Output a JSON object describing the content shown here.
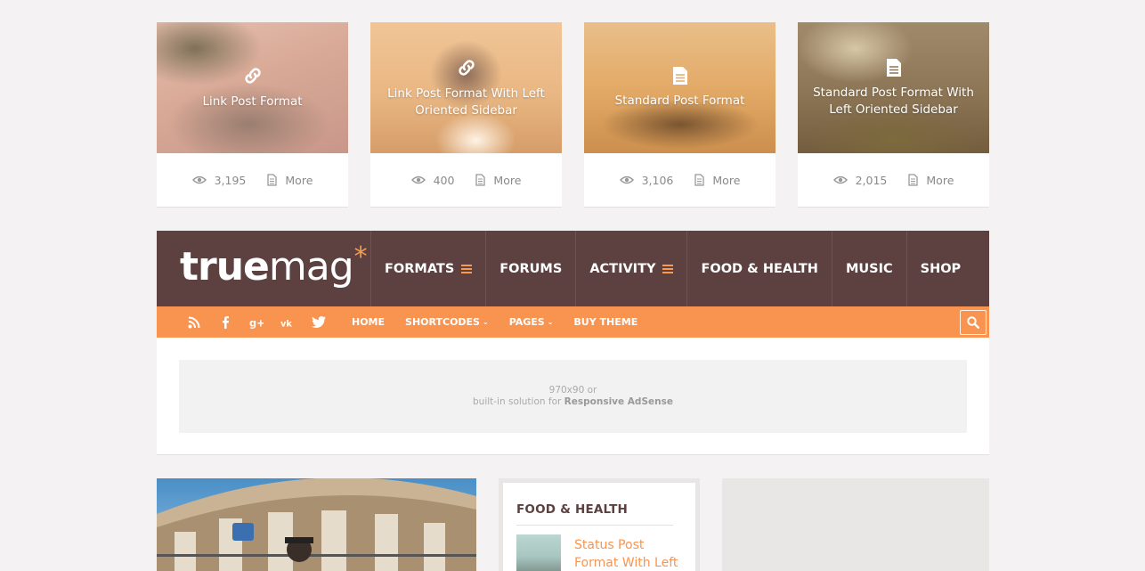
{
  "posts": [
    {
      "title": "Link Post Format",
      "format_icon": "link-icon",
      "views": "3,195",
      "more_label": "More"
    },
    {
      "title": "Link Post Format With Left Oriented Sidebar",
      "format_icon": "link-icon",
      "views": "400",
      "more_label": "More"
    },
    {
      "title": "Standard Post Format",
      "format_icon": "document-icon",
      "views": "3,106",
      "more_label": "More"
    },
    {
      "title": "Standard Post Format With Left Oriented Sidebar",
      "format_icon": "document-icon",
      "views": "2,015",
      "more_label": "More"
    }
  ],
  "header": {
    "logo_bold": "true",
    "logo_light": "mag",
    "logo_star": "*",
    "nav": [
      {
        "label": "FORMATS",
        "has_menu": true
      },
      {
        "label": "FORUMS",
        "has_menu": false
      },
      {
        "label": "ACTIVITY",
        "has_menu": true
      },
      {
        "label": "FOOD & HEALTH",
        "has_menu": false
      },
      {
        "label": "MUSIC",
        "has_menu": false
      },
      {
        "label": "SHOP",
        "has_menu": false
      }
    ]
  },
  "subbar": {
    "social": [
      "rss-icon",
      "facebook-icon",
      "google-plus-icon",
      "vk-icon",
      "twitter-icon"
    ],
    "nav": [
      {
        "label": "HOME",
        "dropdown": false
      },
      {
        "label": "SHORTCODES",
        "dropdown": true
      },
      {
        "label": "PAGES",
        "dropdown": true
      },
      {
        "label": "BUY THEME",
        "dropdown": false
      }
    ]
  },
  "ad": {
    "line1": "970x90 or",
    "line2_prefix": "built-in solution for ",
    "line2_bold": "Responsive AdSense"
  },
  "widget": {
    "title": "FOOD & HEALTH",
    "item_title": "Status Post Format With Left"
  },
  "colors": {
    "header_bg": "#5c4140",
    "accent": "#f99450",
    "page_bg": "#f4f2f2"
  }
}
